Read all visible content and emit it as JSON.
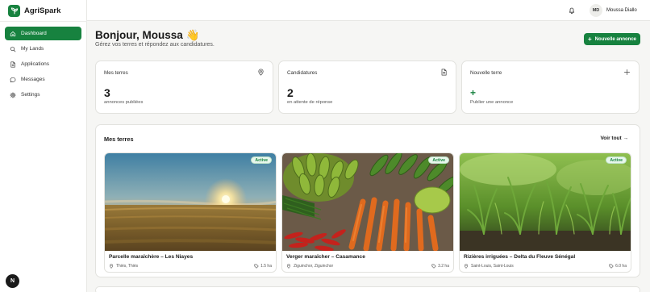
{
  "brand": {
    "name": "AgriSpark"
  },
  "nav": [
    {
      "label": "Dashboard",
      "icon": "home-icon",
      "active": true
    },
    {
      "label": "My Lands",
      "icon": "search-icon"
    },
    {
      "label": "Applications",
      "icon": "document-icon"
    },
    {
      "label": "Messages",
      "icon": "chat-icon"
    },
    {
      "label": "Settings",
      "icon": "gear-icon"
    }
  ],
  "help": {
    "label": "N"
  },
  "user": {
    "initials": "MD",
    "name": "Moussa Diallo"
  },
  "header": {
    "greeting": "Bonjour, Moussa 👋",
    "subtitle": "Gérez vos terres et répondez aux candidatures.",
    "new_button": "Nouvelle annonce"
  },
  "stats": [
    {
      "title": "Mes terres",
      "value": "3",
      "sub": "annonces publiées",
      "icon": "map-pin-icon"
    },
    {
      "title": "Candidatures",
      "value": "2",
      "sub": "en attente de réponse",
      "icon": "document-icon"
    },
    {
      "title": "Nouvelle terre",
      "value": "+",
      "sub": "Publier une annonce",
      "icon": "plus-icon"
    }
  ],
  "lands_section": {
    "title": "Mes terres",
    "see_all": "Voir tout →"
  },
  "lands": [
    {
      "name": "Parcelle maraîchère – Les Niayes",
      "location": "Thiès, Thiès",
      "area": "1.5 ha",
      "status": "Active",
      "image": "sunset-wheat-field"
    },
    {
      "name": "Verger maraîcher – Casamance",
      "location": "Ziguinchor, Ziguinchor",
      "area": "3.2 ha",
      "status": "Active",
      "image": "vegetable-pile"
    },
    {
      "name": "Rizières irriguées – Delta du Fleuve Sénégal",
      "location": "Saint-Louis, Saint-Louis",
      "area": "6.0 ha",
      "status": "Active",
      "image": "young-plants"
    }
  ],
  "colors": {
    "accent": "#17823f",
    "badge_bg": "#e8f7ec",
    "page_bg": "#f6f6f4"
  }
}
